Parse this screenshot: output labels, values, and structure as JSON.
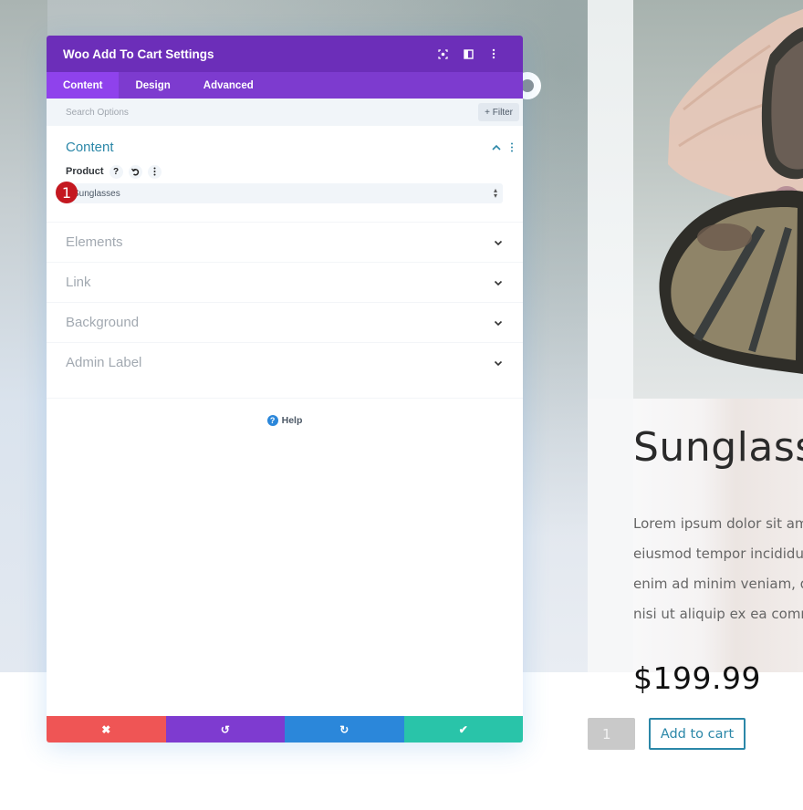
{
  "modal": {
    "title": "Woo Add To Cart Settings",
    "header_icons": [
      "focus-icon",
      "split-view-icon",
      "more-options-icon"
    ],
    "tabs": [
      {
        "label": "Content",
        "active": true
      },
      {
        "label": "Design",
        "active": false
      },
      {
        "label": "Advanced",
        "active": false
      }
    ],
    "search": {
      "placeholder": "Search Options",
      "value": ""
    },
    "filter_label": "+ Filter",
    "open_section": {
      "title": "Content",
      "field": {
        "label": "Product",
        "icons": [
          "help-icon",
          "reset-icon",
          "more-icon"
        ],
        "value": "Sunglasses",
        "badge": "1"
      }
    },
    "sections": [
      {
        "title": "Elements"
      },
      {
        "title": "Link"
      },
      {
        "title": "Background"
      },
      {
        "title": "Admin Label"
      }
    ],
    "help_label": "Help",
    "footer": {
      "cancel": "✖",
      "undo": "↺",
      "redo": "↻",
      "save": "✔"
    }
  },
  "page": {
    "product_title": "Sunglasses",
    "description_lines": [
      "Lorem ipsum dolor sit amet",
      "eiusmod tempor incididunt",
      "enim ad minim veniam, quis",
      "nisi ut aliquip ex ea commodo"
    ],
    "price": "$199.99",
    "quantity": "1",
    "add_to_cart_label": "Add to cart"
  },
  "colors": {
    "header_purple": "#6c2eb9",
    "tab_purple": "#7d3bcf",
    "active_tab": "#8f42ec",
    "accent_teal": "#2b87a8",
    "cancel_red": "#ef5555",
    "redo_blue": "#2b87da",
    "save_green": "#29c4a9",
    "badge_red": "#c41820"
  }
}
